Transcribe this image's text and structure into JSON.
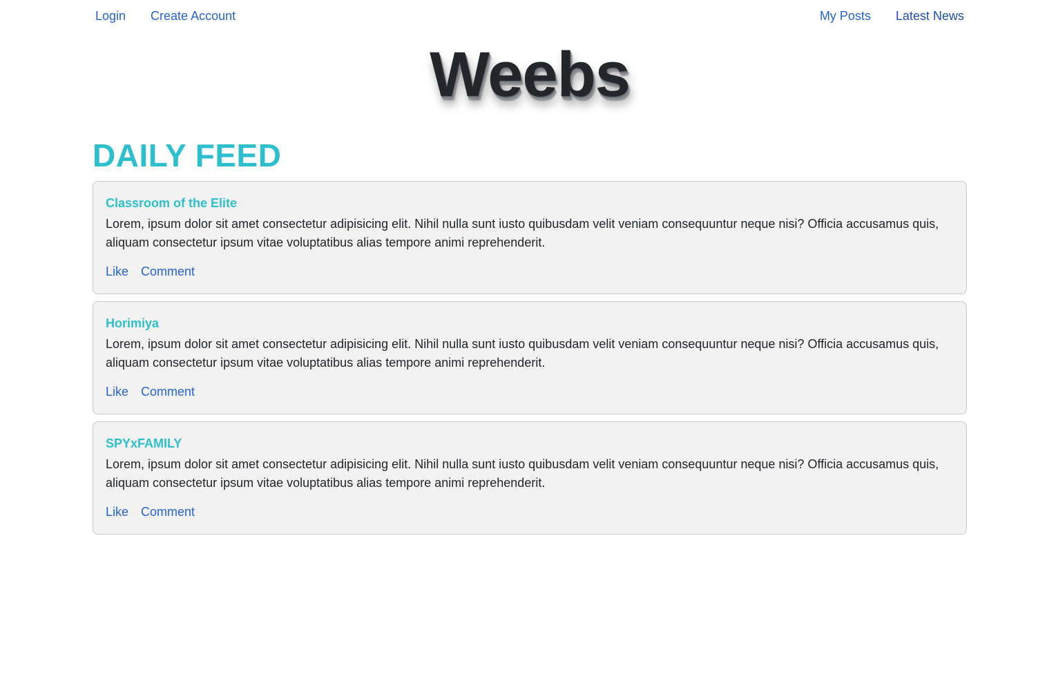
{
  "nav": {
    "left": [
      {
        "label": "Login"
      },
      {
        "label": "Create Account"
      }
    ],
    "right": [
      {
        "label": "My Posts"
      },
      {
        "label": "Latest News"
      }
    ]
  },
  "brand": {
    "title": "Weebs"
  },
  "feed": {
    "heading": "DAILY FEED",
    "posts": [
      {
        "title": "Classroom of the Elite",
        "body": "Lorem, ipsum dolor sit amet consectetur adipisicing elit. Nihil nulla sunt iusto quibusdam velit veniam consequuntur neque nisi? Officia accusamus quis, aliquam consectetur ipsum vitae voluptatibus alias tempore animi reprehenderit.",
        "like_label": "Like",
        "comment_label": "Comment"
      },
      {
        "title": "Horimiya",
        "body": "Lorem, ipsum dolor sit amet consectetur adipisicing elit. Nihil nulla sunt iusto quibusdam velit veniam consequuntur neque nisi? Officia accusamus quis, aliquam consectetur ipsum vitae voluptatibus alias tempore animi reprehenderit.",
        "like_label": "Like",
        "comment_label": "Comment"
      },
      {
        "title": "SPYxFAMILY",
        "body": "Lorem, ipsum dolor sit amet consectetur adipisicing elit. Nihil nulla sunt iusto quibusdam velit veniam consequuntur neque nisi? Officia accusamus quis, aliquam consectetur ipsum vitae voluptatibus alias tempore animi reprehenderit.",
        "like_label": "Like",
        "comment_label": "Comment"
      }
    ]
  },
  "colors": {
    "accent": "#2ebfcf",
    "link": "#2563d9",
    "card_bg": "#f2f2f2",
    "text": "#212529"
  }
}
